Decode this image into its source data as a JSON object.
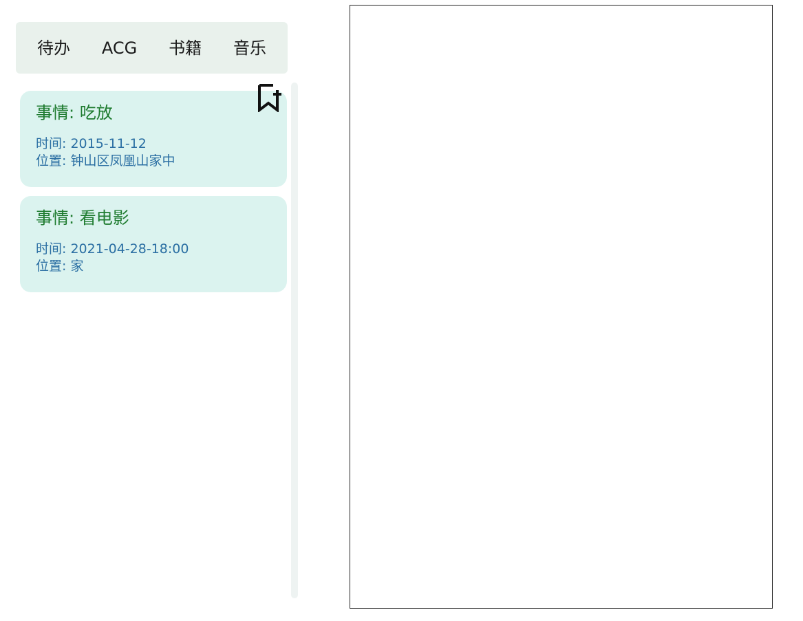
{
  "tabs": [
    {
      "label": "待办"
    },
    {
      "label": "ACG"
    },
    {
      "label": "书籍"
    },
    {
      "label": "音乐"
    }
  ],
  "todos": [
    {
      "title": "事情: 吃放",
      "time": "时间: 2015-11-12",
      "location": "位置: 钟山区凤凰山家中"
    },
    {
      "title": "事情: 看电影",
      "time": "时间: 2021-04-28-18:00",
      "location": "位置: 家"
    }
  ],
  "icons": {
    "add_bookmark": "bookmark-plus-icon"
  },
  "colors": {
    "tab_bar_bg": "#e9f1ec",
    "card_bg": "#dbf3ef",
    "title_color": "#1e7b2f",
    "meta_color": "#2b6fa3"
  }
}
